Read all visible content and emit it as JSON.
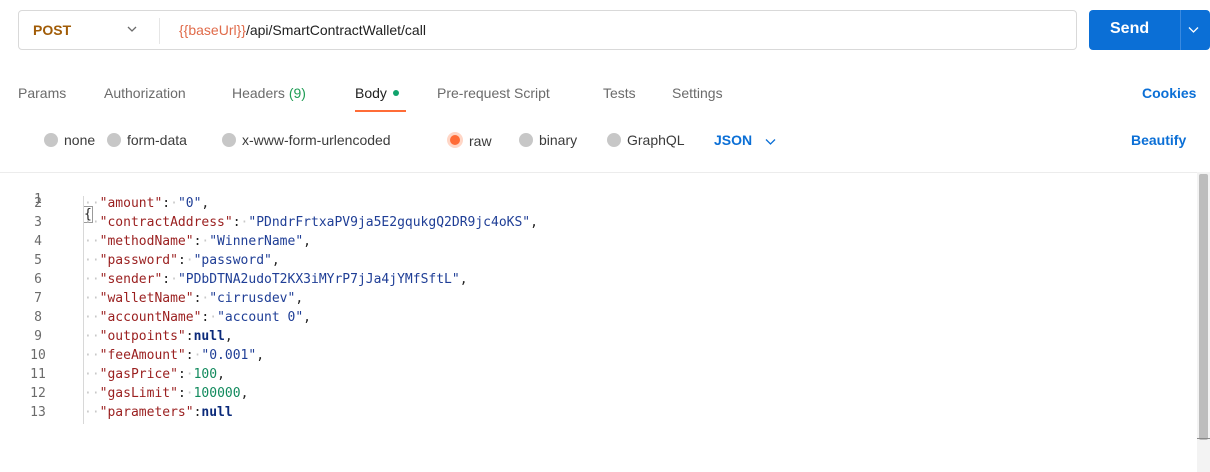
{
  "request": {
    "method": "POST",
    "url_variable": "{{baseUrl}}",
    "url_path": "/api/SmartContractWallet/call",
    "send_label": "Send"
  },
  "tabs": [
    {
      "label": "Params"
    },
    {
      "label": "Authorization"
    },
    {
      "label": "Headers",
      "count": "(9)"
    },
    {
      "label": "Body",
      "active": true,
      "indicator": "green-dot"
    },
    {
      "label": "Pre-request Script"
    },
    {
      "label": "Tests"
    },
    {
      "label": "Settings"
    }
  ],
  "cookies_label": "Cookies",
  "body_types": {
    "options": [
      "none",
      "form-data",
      "x-www-form-urlencoded",
      "raw",
      "binary",
      "GraphQL"
    ],
    "selected": "raw",
    "format": "JSON",
    "beautify_label": "Beautify"
  },
  "editor": {
    "line_numbers": [
      "1",
      "2",
      "3",
      "4",
      "5",
      "6",
      "7",
      "8",
      "9",
      "10",
      "11",
      "12",
      "13"
    ],
    "open_brace": "{",
    "entries": [
      {
        "key": "\"amount\"",
        "value": "\"0\"",
        "type": "string"
      },
      {
        "key": "\"contractAddress\"",
        "value": "\"PDndrFrtxaPV9ja5E2gqukgQ2DR9jc4oKS\"",
        "type": "string"
      },
      {
        "key": "\"methodName\"",
        "value": "\"WinnerName\"",
        "type": "string"
      },
      {
        "key": "\"password\"",
        "value": "\"password\"",
        "type": "string"
      },
      {
        "key": "\"sender\"",
        "value": "\"PDbDTNA2udoT2KX3iMYrP7jJa4jYMfSftL\"",
        "type": "string"
      },
      {
        "key": "\"walletName\"",
        "value": "\"cirrusdev\"",
        "type": "string"
      },
      {
        "key": "\"accountName\"",
        "value": "\"account 0\"",
        "type": "string"
      },
      {
        "key": "\"outpoints\"",
        "value": "null",
        "type": "keyword"
      },
      {
        "key": "\"feeAmount\"",
        "value": "\"0.001\"",
        "type": "string"
      },
      {
        "key": "\"gasPrice\"",
        "value": "100",
        "type": "number"
      },
      {
        "key": "\"gasLimit\"",
        "value": "100000",
        "type": "number"
      },
      {
        "key": "\"parameters\"",
        "value": "null",
        "type": "keyword"
      }
    ]
  },
  "colors": {
    "accent_orange": "#ff6c37",
    "send_blue": "#0b6fd6",
    "method_post": "#a15c07",
    "json_key": "#9a1f1f",
    "json_string": "#1f3e96",
    "json_number": "#118a5d",
    "json_keyword": "#0b2a7a"
  }
}
